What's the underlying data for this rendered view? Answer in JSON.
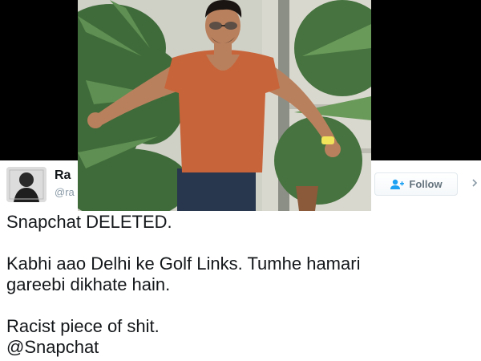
{
  "tweet": {
    "author_name": "Ra",
    "author_handle": "@ra",
    "follow_label": "Follow",
    "lines": [
      "Snapchat DELETED.",
      "Kabhi aao Delhi ke Golf Links. Tumhe hamari",
      "gareebi dikhate hain.",
      "Racist piece of shit.",
      "@Snapchat"
    ]
  },
  "icons": {
    "follow": "add-person-icon",
    "menu": "chevron-down-icon"
  },
  "colors": {
    "follow_blue": "#1da1f2",
    "shirt": "#c8643a",
    "foliage": "#3f6b3a"
  }
}
